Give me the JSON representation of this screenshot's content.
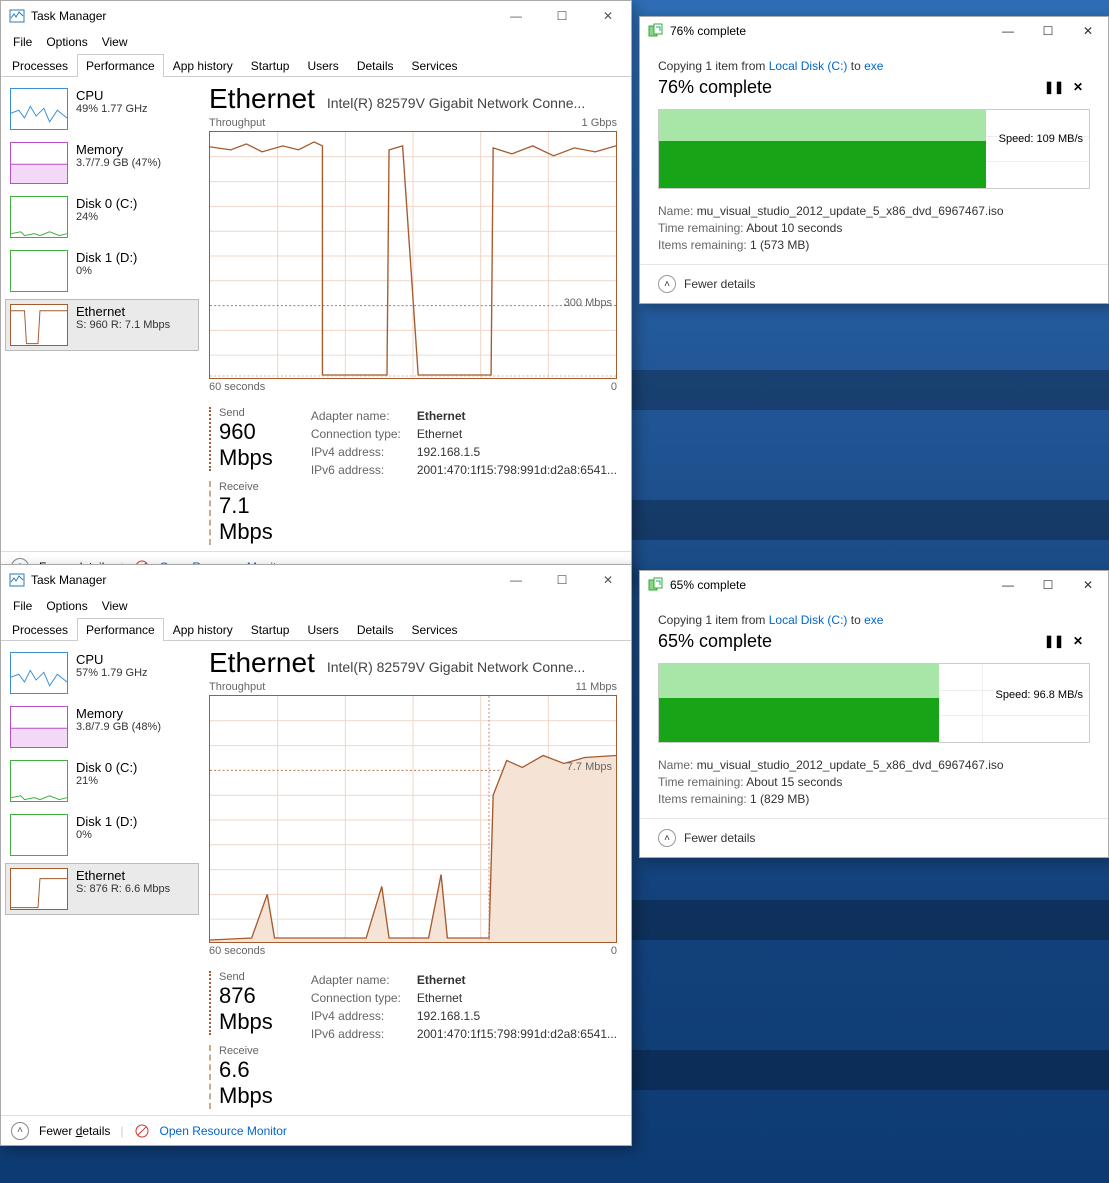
{
  "tm1": {
    "title": "Task Manager",
    "menus": {
      "file": "File",
      "options": "Options",
      "view": "View"
    },
    "tabs": {
      "processes": "Processes",
      "performance": "Performance",
      "apphistory": "App history",
      "startup": "Startup",
      "users": "Users",
      "details": "Details",
      "services": "Services"
    },
    "sidebar": [
      {
        "name": "CPU",
        "sub": "49%  1.77 GHz",
        "color": "#3b8fd6"
      },
      {
        "name": "Memory",
        "sub": "3.7/7.9 GB (47%)",
        "color": "#b84fc9"
      },
      {
        "name": "Disk 0 (C:)",
        "sub": "24%",
        "color": "#3fae3f"
      },
      {
        "name": "Disk 1 (D:)",
        "sub": "0%",
        "color": "#3fae3f"
      },
      {
        "name": "Ethernet",
        "sub": "S: 960 R: 7.1 Mbps",
        "color": "#a65a2e",
        "selected": true
      }
    ],
    "main": {
      "title": "Ethernet",
      "sub": "Intel(R) 82579V Gigabit Network Conne...",
      "ylabel_l": "Throughput",
      "ylabel_r": "1 Gbps",
      "dashed_label": "300 Mbps",
      "xlabel_l": "60 seconds",
      "xlabel_r": "0",
      "send_lbl": "Send",
      "send_val": "960 Mbps",
      "recv_lbl": "Receive",
      "recv_val": "7.1 Mbps",
      "props": {
        "adapter_k": "Adapter name:",
        "adapter_v": "Ethernet",
        "conn_k": "Connection type:",
        "conn_v": "Ethernet",
        "ipv4_k": "IPv4 address:",
        "ipv4_v": "192.168.1.5",
        "ipv6_k": "IPv6 address:",
        "ipv6_v": "2001:470:1f15:798:991d:d2a8:6541..."
      }
    },
    "footer": {
      "fewer": "Fewer ",
      "fewer_u": "d",
      "fewer2": "etails",
      "orm": "Open Resource Monitor"
    }
  },
  "tm2": {
    "title": "Task Manager",
    "sidebar": [
      {
        "name": "CPU",
        "sub": "57%  1.79 GHz",
        "color": "#3b8fd6"
      },
      {
        "name": "Memory",
        "sub": "3.8/7.9 GB (48%)",
        "color": "#b84fc9"
      },
      {
        "name": "Disk 0 (C:)",
        "sub": "21%",
        "color": "#3fae3f"
      },
      {
        "name": "Disk 1 (D:)",
        "sub": "0%",
        "color": "#3fae3f"
      },
      {
        "name": "Ethernet",
        "sub": "S: 876 R: 6.6 Mbps",
        "color": "#a65a2e",
        "selected": true
      }
    ],
    "main": {
      "title": "Ethernet",
      "sub": "Intel(R) 82579V Gigabit Network Conne...",
      "ylabel_l": "Throughput",
      "ylabel_r": "11 Mbps",
      "dashed_label": "7.7 Mbps",
      "xlabel_l": "60 seconds",
      "xlabel_r": "0",
      "send_lbl": "Send",
      "send_val": "876 Mbps",
      "recv_lbl": "Receive",
      "recv_val": "6.6 Mbps",
      "props": {
        "adapter_k": "Adapter name:",
        "adapter_v": "Ethernet",
        "conn_k": "Connection type:",
        "conn_v": "Ethernet",
        "ipv4_k": "IPv4 address:",
        "ipv4_v": "192.168.1.5",
        "ipv6_k": "IPv6 address:",
        "ipv6_v": "2001:470:1f15:798:991d:d2a8:6541..."
      }
    }
  },
  "cp1": {
    "title": "76% complete",
    "line_pre": "Copying 1 item from ",
    "src": "Local Disk (C:)",
    "mid": " to ",
    "dst": "exe",
    "pct": "76% complete",
    "speed": "Speed: 109 MB/s",
    "progress_frac": 0.76,
    "speed_frac": 0.48,
    "speed_y": 0.35,
    "name_k": "Name:  ",
    "name_v": "mu_visual_studio_2012_update_5_x86_dvd_6967467.iso",
    "time_k": "Time remaining:  ",
    "time_v": "About 10 seconds",
    "items_k": "Items remaining:  ",
    "items_v": "1 (573 MB)",
    "fewer": "Fewer details"
  },
  "cp2": {
    "title": "65% complete",
    "line_pre": "Copying 1 item from ",
    "src": "Local Disk (C:)",
    "mid": " to ",
    "dst": "exe",
    "pct": "65% complete",
    "speed": "Speed: 96.8 MB/s",
    "progress_frac": 0.65,
    "speed_frac": 0.45,
    "speed_y": 0.38,
    "name_k": "Name:  ",
    "name_v": "mu_visual_studio_2012_update_5_x86_dvd_6967467.iso",
    "time_k": "Time remaining:  ",
    "time_v": "About 15 seconds",
    "items_k": "Items remaining:  ",
    "items_v": "1 (829 MB)",
    "fewer": "Fewer details"
  }
}
